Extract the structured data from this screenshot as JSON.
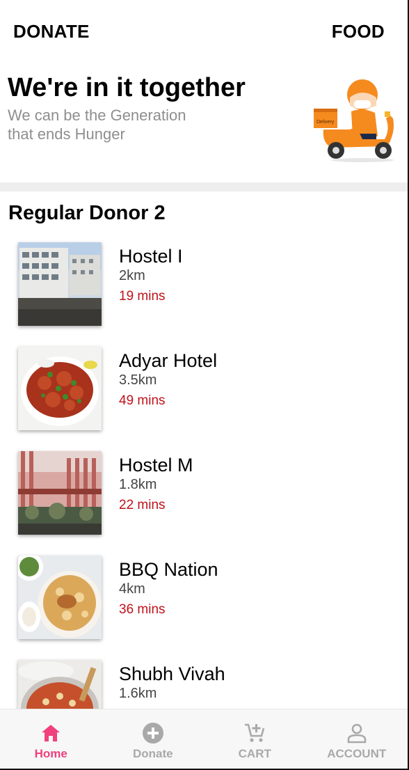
{
  "header": {
    "left_link": "DONATE",
    "right_link": "FOOD"
  },
  "hero": {
    "title": "We're in it together",
    "subtitle": "We can be the Generation that ends Hunger",
    "illustration_label": "Delivery"
  },
  "section": {
    "title": "Regular Donor 2"
  },
  "donors": [
    {
      "name": "Hostel I",
      "distance": "2km",
      "time": "19 mins",
      "image": "building-photo"
    },
    {
      "name": "Adyar Hotel",
      "distance": "3.5km",
      "time": "49 mins",
      "image": "chicken-dish-photo"
    },
    {
      "name": "Hostel M",
      "distance": "1.8km",
      "time": "22 mins",
      "image": "building-photo"
    },
    {
      "name": "BBQ Nation",
      "distance": "4km",
      "time": "36 mins",
      "image": "biryani-photo"
    },
    {
      "name": "Shubh Vivah",
      "distance": "1.6km",
      "time": "",
      "image": "pasta-dish-photo"
    }
  ],
  "bottom_nav": [
    {
      "label": "Home",
      "icon": "home-icon",
      "active": true
    },
    {
      "label": "Donate",
      "icon": "add-circle-icon",
      "active": false
    },
    {
      "label": "CART",
      "icon": "cart-icon",
      "active": false
    },
    {
      "label": "ACCOUNT",
      "icon": "account-icon",
      "active": false
    }
  ],
  "colors": {
    "accent": "#f0407e",
    "time_text": "#c0111a",
    "muted": "#a9a9a9",
    "subtitle": "#8e8e8e"
  }
}
